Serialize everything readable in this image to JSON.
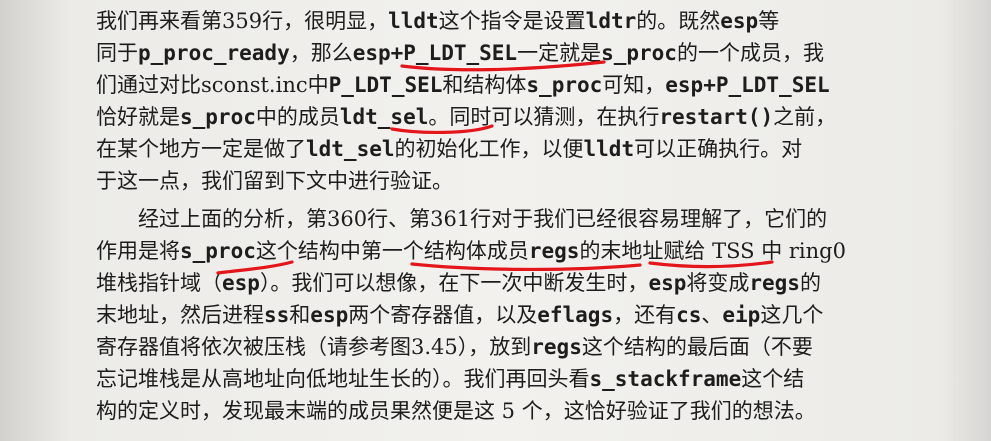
{
  "paragraphs": [
    {
      "lines": [
        [
          "我们再来看第359行，很明显，",
          {
            "c": "lldt"
          },
          "这个指令是设置",
          {
            "c": "ldtr"
          },
          "的。既然",
          {
            "c": "esp"
          },
          "等"
        ],
        [
          "同于",
          {
            "c": "p_proc_ready"
          },
          "，那么",
          {
            "c": "esp+P_LDT_SEL"
          },
          "一定就是",
          {
            "c": "s_proc"
          },
          "的一个成员，我"
        ],
        [
          "们通过对比sconst.inc中",
          {
            "c": "P_LDT_SEL"
          },
          "和结构体",
          {
            "c": "s_proc"
          },
          "可知，",
          {
            "c": "esp+P_LDT_SEL"
          }
        ],
        [
          "恰好就是",
          {
            "c": "s_proc"
          },
          "中的成员",
          {
            "c": "ldt_sel"
          },
          "。同时可以猜测，在执行",
          {
            "c": "restart()"
          },
          "之前，"
        ],
        [
          "在某个地方一定是做了",
          {
            "c": "ldt_sel"
          },
          "的初始化工作，以便",
          {
            "c": "lldt"
          },
          "可以正确执行。对"
        ],
        [
          "于这一点，我们留到下文中进行验证。"
        ]
      ]
    },
    {
      "lines": [
        [
          "　　经过上面的分析，第360行、第361行对于我们已经很容易理解了，它们的"
        ],
        [
          "作用是将",
          {
            "c": "s_proc"
          },
          "这个结构中第一个结构体成员",
          {
            "c": "regs"
          },
          "的末地址赋给 TSS 中 ring0"
        ],
        [
          "堆栈指针域（",
          {
            "c": "esp"
          },
          "）。我们可以想像，在下一次中断发生时，",
          {
            "c": "esp"
          },
          "将变成",
          {
            "c": "regs"
          },
          "的"
        ],
        [
          "末地址，然后进程",
          {
            "c": "ss"
          },
          "和",
          {
            "c": "esp"
          },
          "两个寄存器值，以及",
          {
            "c": "eflags"
          },
          "，还有",
          {
            "c": "cs"
          },
          "、",
          {
            "c": "eip"
          },
          "这几个"
        ],
        [
          "寄存器值将依次被压栈（请参考图3.45），放到",
          {
            "c": "regs"
          },
          "这个结构的最后面（不要"
        ],
        [
          "忘记堆栈是从高地址向低地址生长的）。我们再回头看",
          {
            "c": "s_stackframe"
          },
          "这个结"
        ],
        [
          "构的定义时，发现最末端的成员果然便是这 5 个，这恰好验证了我们的想法。"
        ]
      ]
    }
  ],
  "annotation_color": "#e4161b"
}
